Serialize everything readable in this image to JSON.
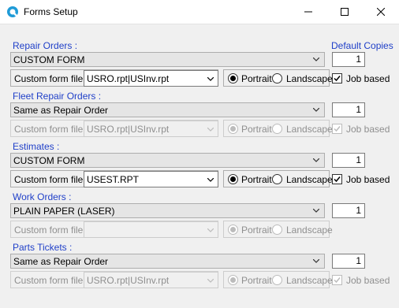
{
  "window": {
    "title": "Forms Setup",
    "icon": "app-logo-icon"
  },
  "default_copies_label": "Default Copies",
  "custom_form_label": "Custom form file :",
  "portrait_label": "Portrait",
  "landscape_label": "Landscape",
  "job_based_label": "Job based",
  "sections": [
    {
      "label": "Repair Orders :",
      "form": "CUSTOM FORM",
      "copies": "1",
      "custom_file": "USRO.rpt|USInv.rpt",
      "orientation": "Portrait",
      "job_based": true,
      "enabled": true
    },
    {
      "label": "Fleet Repair Orders :",
      "form": "Same as Repair Order",
      "copies": "1",
      "custom_file": "USRO.rpt|USInv.rpt",
      "orientation": "Portrait",
      "job_based": true,
      "enabled": false
    },
    {
      "label": "Estimates :",
      "form": "CUSTOM FORM",
      "copies": "1",
      "custom_file": "USEST.RPT",
      "orientation": "Portrait",
      "job_based": true,
      "enabled": true
    },
    {
      "label": "Work Orders :",
      "form": "PLAIN PAPER (LASER)",
      "copies": "1",
      "custom_file": "",
      "orientation": "Portrait",
      "job_based": null,
      "enabled": false
    },
    {
      "label": "Parts Tickets :",
      "form": "Same as Repair Order",
      "copies": "1",
      "custom_file": "USRO.rpt|USInv.rpt",
      "orientation": "Portrait",
      "job_based": true,
      "enabled": false
    }
  ]
}
